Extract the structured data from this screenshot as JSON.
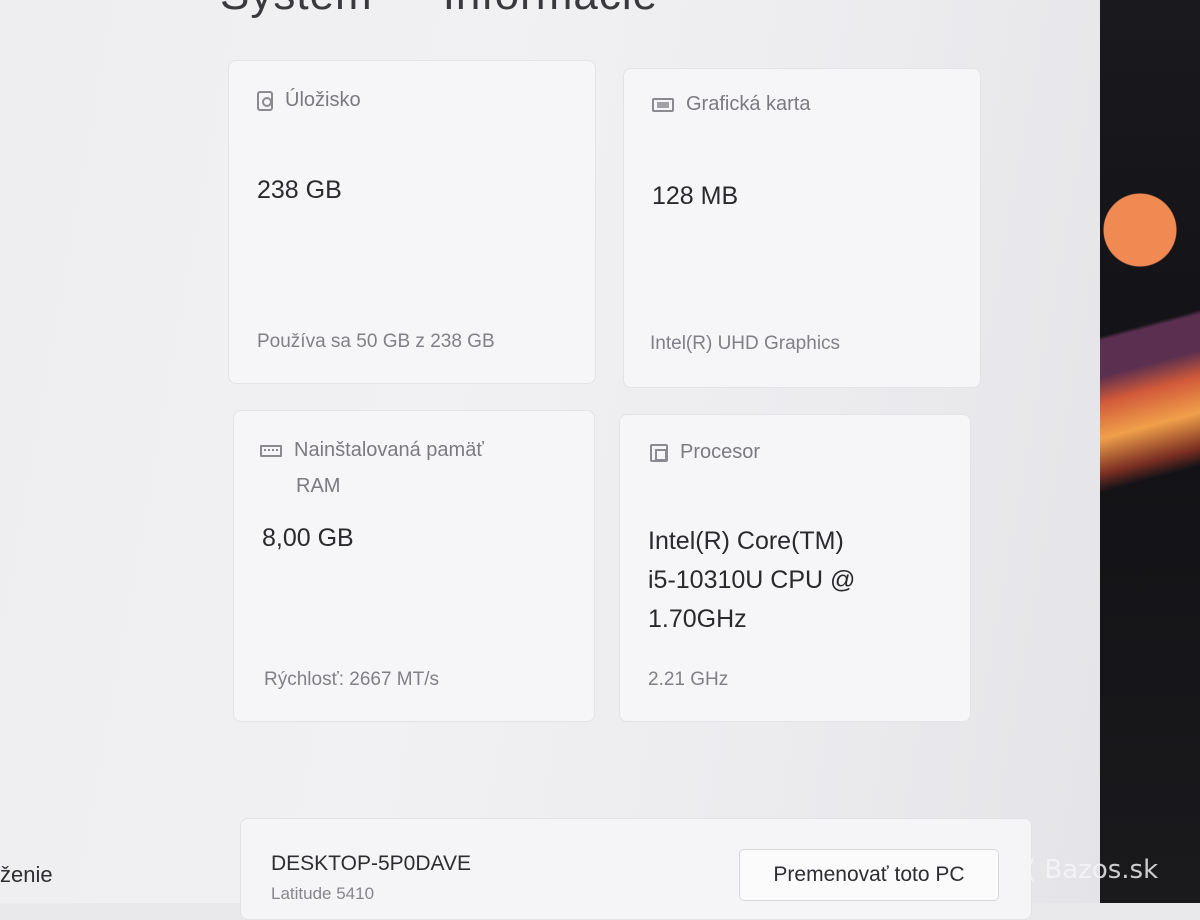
{
  "page": {
    "heading_left": "Systém",
    "heading_right": "Informácie"
  },
  "cards": {
    "storage": {
      "title": "Úložisko",
      "icon": "hard-drive-icon",
      "value": "238 GB",
      "sub": "Používa sa 50 GB z 238 GB"
    },
    "gpu": {
      "title": "Grafická karta",
      "icon": "display-adapter-icon",
      "value": "128 MB",
      "sub": "Intel(R) UHD Graphics"
    },
    "ram": {
      "title_line1": "Nainštalovaná pamäť",
      "title_line2": "RAM",
      "icon": "memory-icon",
      "value": "8,00 GB",
      "sub": "Rýchlosť: 2667 MT/s"
    },
    "cpu": {
      "title": "Procesor",
      "icon": "processor-icon",
      "value_line1": "Intel(R) Core(TM)",
      "value_line2": "i5-10310U CPU @",
      "value_line3": "1.70GHz",
      "sub": "2.21 GHz"
    }
  },
  "device": {
    "name": "DESKTOP-5P0DAVE",
    "model": "Latitude 5410",
    "rename_label": "Premenovať toto PC"
  },
  "nav": {
    "partial_label": "ženie"
  },
  "watermark": "@( Bazos.sk"
}
